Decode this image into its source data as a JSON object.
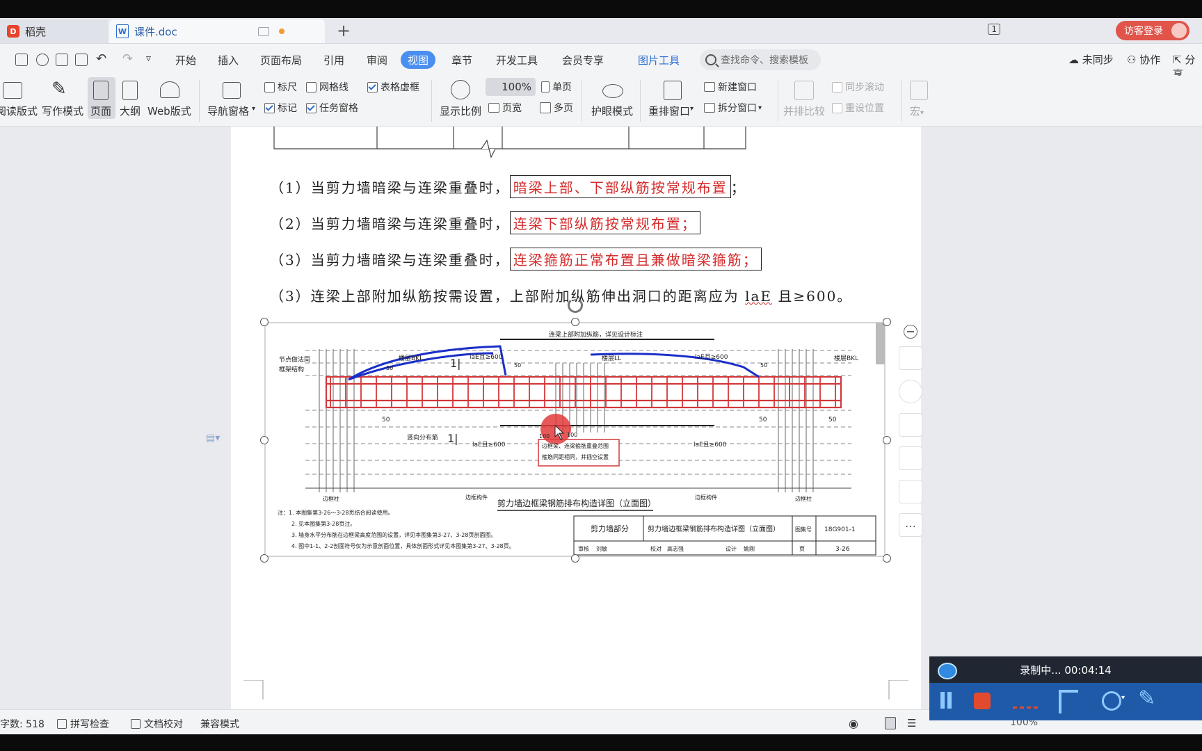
{
  "tabs": {
    "home_label": "稻壳",
    "doc_label": "课件.doc",
    "page_count": "1",
    "login_label": "访客登录"
  },
  "menu": {
    "items": [
      "开始",
      "插入",
      "页面布局",
      "引用",
      "审阅",
      "视图",
      "章节",
      "开发工具",
      "会员专享"
    ],
    "active": "视图",
    "picture_tools": "图片工具",
    "search_placeholder": "查找命令、搜索模板",
    "unsynced": "未同步",
    "collab": "协作",
    "share": "分享"
  },
  "ribbon": {
    "read_mode": "阅读版式",
    "write_mode": "写作模式",
    "page": "页面",
    "outline": "大纲",
    "web_mode": "Web版式",
    "nav_pane": "导航窗格",
    "ruler": "标尺",
    "gridlines": "网格线",
    "table_dash": "表格虚框",
    "marks": "标记",
    "task_pane": "任务窗格",
    "zoom_ratio": "显示比例",
    "zoom_value": "100%",
    "single_page": "单页",
    "page_width": "页宽",
    "multi_page": "多页",
    "eye_mode": "护眼模式",
    "rearrange": "重排窗口",
    "new_window": "新建窗口",
    "split_window": "拆分窗口",
    "side_compare": "并排比较",
    "sync_scroll": "同步滚动",
    "reset_pos": "重设位置",
    "macro": "宏"
  },
  "document": {
    "para1_prefix": "（1）当剪力墙暗梁与连梁重叠时，",
    "para1_red": "暗梁上部、下部纵筋按常规布置",
    "para1_suffix": "；",
    "para2_prefix": "（2）当剪力墙暗梁与连梁重叠时，",
    "para2_red": "连梁下部纵筋按常规布置；",
    "para3_prefix": "（3）当剪力墙暗梁与连梁重叠时，",
    "para3_red": "连梁箍筋正常布置且兼做暗梁箍筋；",
    "para4_prefix": "（3）连梁上部附加纵筋按需设置，上部附加纵筋伸出洞口的距离应为 ",
    "para4_lae": "laE",
    "para4_suffix": " 且≥600。"
  },
  "figure": {
    "top_note": "连梁上部附加纵筋，详见设计标注",
    "left_note1": "节点做法同",
    "left_note2": "框架结构",
    "bkl_left": "楼层BKL",
    "ll_mid": "楼层LL",
    "bkl_right": "楼层BKL",
    "lae_1": "laE且≥600",
    "lae_2": "laE且≥600",
    "lae_3": "laE且≥600",
    "lae_4": "laE且≥600",
    "vertical_dist": "竖向分布筋",
    "dim_50_a": "50",
    "dim_50_b": "50",
    "dim_50_c": "50",
    "dim_50_d": "50",
    "dim_50_e": "50",
    "dim_50_f": "50",
    "dim_100_a": "100",
    "dim_100_b": "100",
    "section_1": "1|",
    "section_2": "1|",
    "callout1": "边框梁、连梁箍筋重叠范围",
    "callout2": "箍筋同距相同，并插空设置",
    "caption": "剪力墙边框梁钢筋排布构造详图（立面图）",
    "col_left": "边框柱",
    "col_mid_left": "边框构件",
    "col_mid_right": "边框构件",
    "col_right": "边框柱",
    "notes": [
      "注：1. 本图集第3-26～3-28页结合阅读使用。",
      "2. 见本图集第3-28页注。",
      "3. 墙身水平分布筋在边框梁高度范围的设置，详见本图集第3-27、3-28页剖面图。",
      "4. 图中1-1、2-2剖面符号仅为示意剖面位置，具体剖面形式详见本图集第3-27、3-28页。"
    ],
    "tb_section": "剪力墙部分",
    "tb_title": "剪力墙边框梁钢筋排布构造详图（立面图）",
    "tb_atlas_label": "图集号",
    "tb_atlas": "18G901-1",
    "tb_review": "审核",
    "tb_reviewer": "刘敏",
    "tb_check": "校对",
    "tb_checker": "高志强",
    "tb_design": "设计",
    "tb_designer": "姚刚",
    "tb_page_label": "页",
    "tb_page": "3-26"
  },
  "status": {
    "word_count": "字数: 518",
    "spell_check": "拼写检查",
    "doc_check": "文档校对",
    "compat": "兼容模式",
    "zoom": "100%"
  },
  "recorder": {
    "status": "录制中... 00:04:14"
  },
  "colors": {
    "accent": "#4a8ef0",
    "red_text": "#d42a2a",
    "rebar_red": "#d2383a",
    "annotation_blue": "#1a2fc8",
    "recorder_bg": "#1e5aa8",
    "login_bg": "#e0544a"
  },
  "icons": [
    "docer-logo-icon",
    "doc-icon",
    "plus-icon",
    "save-icon",
    "print-icon",
    "undo-icon",
    "redo-icon",
    "search-icon",
    "cloud-icon",
    "collab-icon",
    "share-icon",
    "zoom-icon",
    "eye-icon",
    "pause-icon",
    "stop-icon",
    "pen-icon",
    "cursor-highlight-icon"
  ]
}
